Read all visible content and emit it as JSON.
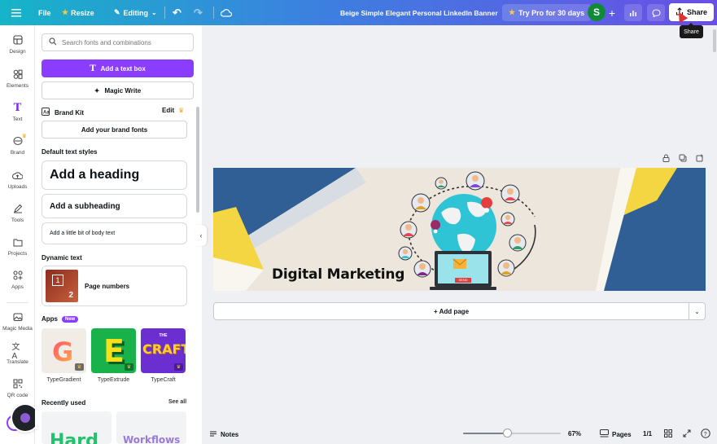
{
  "topbar": {
    "file": "File",
    "resize": "Resize",
    "editing": "Editing",
    "document_title": "Beige Simple Elegant Personal LinkedIn Banner",
    "try_pro": "Try Pro for 30 days",
    "avatar_initial": "S",
    "share": "Share",
    "tooltip": "Share",
    "colors": {
      "gradient_start": "#16b4c8",
      "gradient_end": "#6a4ee6"
    }
  },
  "rail": {
    "items": [
      {
        "label": "Design",
        "icon": "layout-icon"
      },
      {
        "label": "Elements",
        "icon": "shapes-icon"
      },
      {
        "label": "Text",
        "icon": "text-icon",
        "active": true
      },
      {
        "label": "Brand",
        "icon": "brand-icon"
      },
      {
        "label": "Uploads",
        "icon": "cloud-upload-icon"
      },
      {
        "label": "Tools",
        "icon": "pen-icon"
      },
      {
        "label": "Projects",
        "icon": "folder-icon"
      },
      {
        "label": "Apps",
        "icon": "apps-icon"
      },
      {
        "label": "Magic Media",
        "icon": "magic-media-icon"
      },
      {
        "label": "Translate",
        "icon": "translate-icon"
      },
      {
        "label": "QR code",
        "icon": "qr-icon"
      }
    ]
  },
  "panel": {
    "search_placeholder": "Search fonts and combinations",
    "add_text_box": "Add a text box",
    "magic_write": "Magic Write",
    "brand_kit": "Brand Kit",
    "edit": "Edit",
    "add_brand_fonts": "Add your brand fonts",
    "default_styles_title": "Default text styles",
    "heading": "Add a heading",
    "subheading": "Add a subheading",
    "body": "Add a little bit of body text",
    "dynamic_title": "Dynamic text",
    "page_numbers": "Page numbers",
    "page_number_digit_1": "1",
    "page_number_digit_2": "2",
    "apps_title": "Apps",
    "apps_badge": "New",
    "apps": [
      {
        "name": "TypeGradient",
        "tile_text": "G"
      },
      {
        "name": "TypeExtrude",
        "tile_text": "E"
      },
      {
        "name": "TypeCraft",
        "tile_text": "CRAFT",
        "tile_small": "THE"
      }
    ],
    "recent_title": "Recently used",
    "see_all": "See all",
    "recent_items": [
      "Hard",
      "Workflows"
    ]
  },
  "canvas": {
    "headline": "Digital Marketing",
    "laptop_label": "SEND",
    "add_page": "+ Add page",
    "colors": {
      "navy": "#2f5f94",
      "yellow": "#f4d542",
      "beige": "#ece6dd",
      "teal": "#2ec4d6"
    }
  },
  "bottombar": {
    "notes": "Notes",
    "zoom": "67%",
    "zoom_fraction": 0.45,
    "pages": "Pages",
    "page_count": "1/1"
  }
}
